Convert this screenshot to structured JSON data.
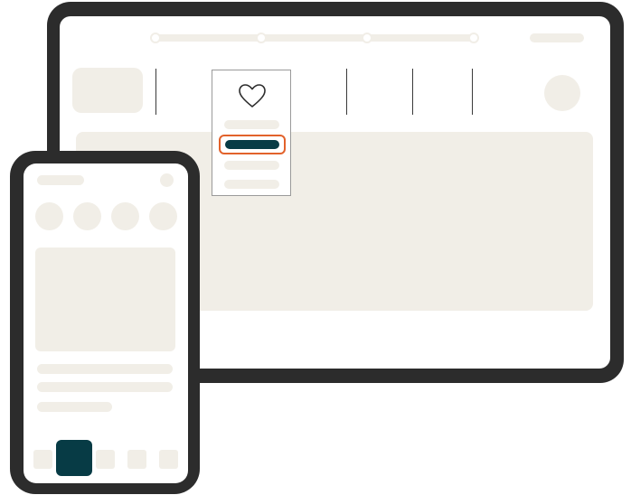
{
  "colors": {
    "device_frame": "#2c2c2c",
    "placeholder": "#f1eee7",
    "accent_dark": "#073b45",
    "highlight_outline": "#e2622b"
  },
  "tablet": {
    "stepper_steps": 4,
    "nav_icon": "heart-icon",
    "dropdown_selected_index": 1
  },
  "phone": {
    "tab_count": 5,
    "selected_tab_index": 1
  }
}
